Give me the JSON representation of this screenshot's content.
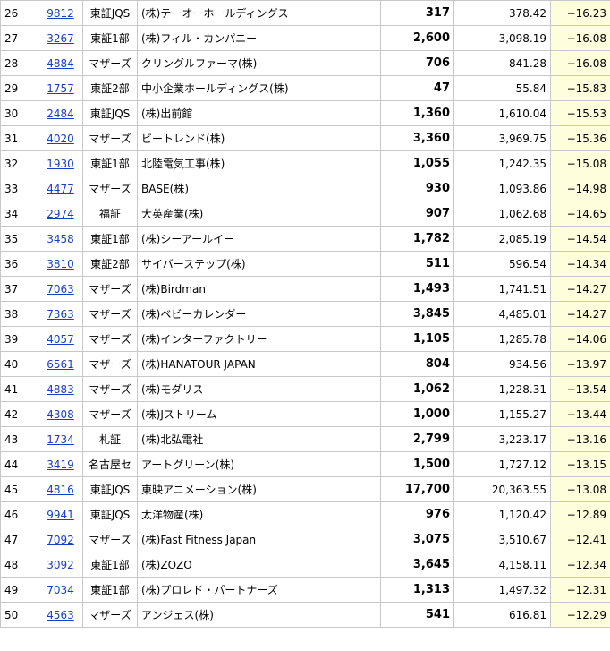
{
  "rows": [
    {
      "rank": "26",
      "code": "9812",
      "market": "東証JQS",
      "name": "(株)テーオーホールディングス",
      "price": "317",
      "prev": "378.42",
      "change": "−16.23"
    },
    {
      "rank": "27",
      "code": "3267",
      "market": "東証1部",
      "name": "(株)フィル・カンパニー",
      "price": "2,600",
      "prev": "3,098.19",
      "change": "−16.08"
    },
    {
      "rank": "28",
      "code": "4884",
      "market": "マザーズ",
      "name": "クリングルファーマ(株)",
      "price": "706",
      "prev": "841.28",
      "change": "−16.08"
    },
    {
      "rank": "29",
      "code": "1757",
      "market": "東証2部",
      "name": "中小企業ホールディングス(株)",
      "price": "47",
      "prev": "55.84",
      "change": "−15.83"
    },
    {
      "rank": "30",
      "code": "2484",
      "market": "東証JQS",
      "name": "(株)出前館",
      "price": "1,360",
      "prev": "1,610.04",
      "change": "−15.53"
    },
    {
      "rank": "31",
      "code": "4020",
      "market": "マザーズ",
      "name": "ビートレンド(株)",
      "price": "3,360",
      "prev": "3,969.75",
      "change": "−15.36"
    },
    {
      "rank": "32",
      "code": "1930",
      "market": "東証1部",
      "name": "北陸電気工事(株)",
      "price": "1,055",
      "prev": "1,242.35",
      "change": "−15.08"
    },
    {
      "rank": "33",
      "code": "4477",
      "market": "マザーズ",
      "name": "BASE(株)",
      "price": "930",
      "prev": "1,093.86",
      "change": "−14.98"
    },
    {
      "rank": "34",
      "code": "2974",
      "market": "福証",
      "name": "大英産業(株)",
      "price": "907",
      "prev": "1,062.68",
      "change": "−14.65"
    },
    {
      "rank": "35",
      "code": "3458",
      "market": "東証1部",
      "name": "(株)シーアールイー",
      "price": "1,782",
      "prev": "2,085.19",
      "change": "−14.54"
    },
    {
      "rank": "36",
      "code": "3810",
      "market": "東証2部",
      "name": "サイバーステップ(株)",
      "price": "511",
      "prev": "596.54",
      "change": "−14.34"
    },
    {
      "rank": "37",
      "code": "7063",
      "market": "マザーズ",
      "name": "(株)Birdman",
      "price": "1,493",
      "prev": "1,741.51",
      "change": "−14.27"
    },
    {
      "rank": "38",
      "code": "7363",
      "market": "マザーズ",
      "name": "(株)ベビーカレンダー",
      "price": "3,845",
      "prev": "4,485.01",
      "change": "−14.27"
    },
    {
      "rank": "39",
      "code": "4057",
      "market": "マザーズ",
      "name": "(株)インターファクトリー",
      "price": "1,105",
      "prev": "1,285.78",
      "change": "−14.06"
    },
    {
      "rank": "40",
      "code": "6561",
      "market": "マザーズ",
      "name": "(株)HANATOUR JAPAN",
      "price": "804",
      "prev": "934.56",
      "change": "−13.97"
    },
    {
      "rank": "41",
      "code": "4883",
      "market": "マザーズ",
      "name": "(株)モダリス",
      "price": "1,062",
      "prev": "1,228.31",
      "change": "−13.54"
    },
    {
      "rank": "42",
      "code": "4308",
      "market": "マザーズ",
      "name": "(株)Jストリーム",
      "price": "1,000",
      "prev": "1,155.27",
      "change": "−13.44"
    },
    {
      "rank": "43",
      "code": "1734",
      "market": "札証",
      "name": "(株)北弘電社",
      "price": "2,799",
      "prev": "3,223.17",
      "change": "−13.16"
    },
    {
      "rank": "44",
      "code": "3419",
      "market": "名古屋セ",
      "name": "アートグリーン(株)",
      "price": "1,500",
      "prev": "1,727.12",
      "change": "−13.15"
    },
    {
      "rank": "45",
      "code": "4816",
      "market": "東証JQS",
      "name": "東映アニメーション(株)",
      "price": "17,700",
      "prev": "20,363.55",
      "change": "−13.08"
    },
    {
      "rank": "46",
      "code": "9941",
      "market": "東証JQS",
      "name": "太洋物産(株)",
      "price": "976",
      "prev": "1,120.42",
      "change": "−12.89"
    },
    {
      "rank": "47",
      "code": "7092",
      "market": "マザーズ",
      "name": "(株)Fast Fitness Japan",
      "price": "3,075",
      "prev": "3,510.67",
      "change": "−12.41"
    },
    {
      "rank": "48",
      "code": "3092",
      "market": "東証1部",
      "name": "(株)ZOZO",
      "price": "3,645",
      "prev": "4,158.11",
      "change": "−12.34"
    },
    {
      "rank": "49",
      "code": "7034",
      "market": "東証1部",
      "name": "(株)プロレド・パートナーズ",
      "price": "1,313",
      "prev": "1,497.32",
      "change": "−12.31"
    },
    {
      "rank": "50",
      "code": "4563",
      "market": "マザーズ",
      "name": "アンジェス(株)",
      "price": "541",
      "prev": "616.81",
      "change": "−12.29"
    }
  ],
  "colors": {
    "link": "#1a3cc8",
    "change_bg": "#fefedc",
    "border": "#c8c8c8"
  }
}
